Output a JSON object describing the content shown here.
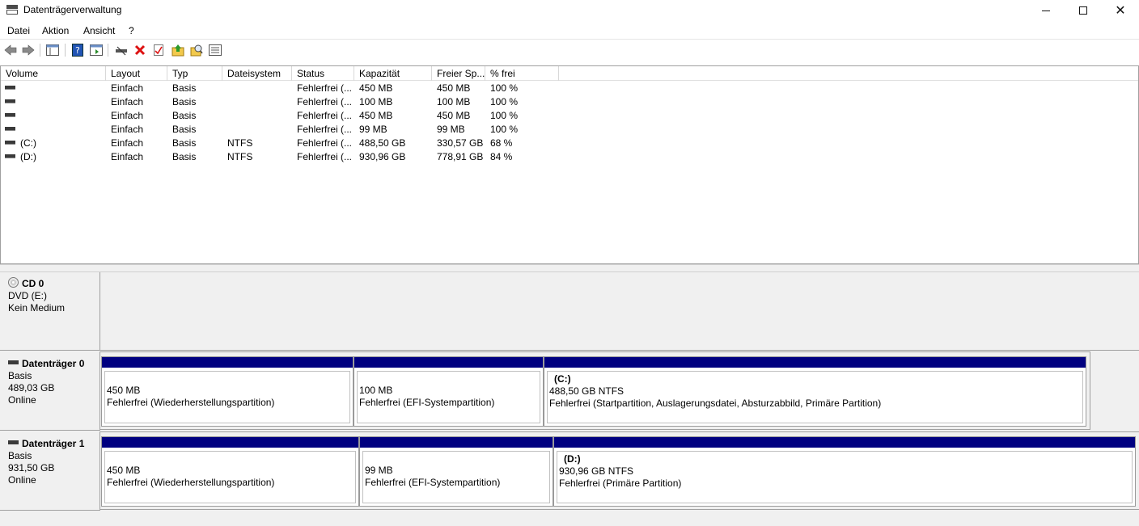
{
  "window": {
    "title": "Datenträgerverwaltung"
  },
  "menu": [
    "Datei",
    "Aktion",
    "Ansicht",
    "?"
  ],
  "toolbar": {
    "icons": [
      "back-arrow-icon",
      "forward-arrow-icon",
      "console-tree-icon",
      "help-icon",
      "action-pane-icon",
      "connect-drive-icon",
      "delete-icon",
      "properties-icon",
      "refresh-icon",
      "rescan-icon",
      "details-view-icon"
    ]
  },
  "volume_list": {
    "columns": [
      "Volume",
      "Layout",
      "Typ",
      "Dateisystem",
      "Status",
      "Kapazität",
      "Freier Sp...",
      "% frei"
    ],
    "rows": [
      {
        "volume": "",
        "layout": "Einfach",
        "typ": "Basis",
        "fs": "",
        "status": "Fehlerfrei (...",
        "kap": "450 MB",
        "frei": "450 MB",
        "pct": "100 %"
      },
      {
        "volume": "",
        "layout": "Einfach",
        "typ": "Basis",
        "fs": "",
        "status": "Fehlerfrei (...",
        "kap": "100 MB",
        "frei": "100 MB",
        "pct": "100 %"
      },
      {
        "volume": "",
        "layout": "Einfach",
        "typ": "Basis",
        "fs": "",
        "status": "Fehlerfrei (...",
        "kap": "450 MB",
        "frei": "450 MB",
        "pct": "100 %"
      },
      {
        "volume": "",
        "layout": "Einfach",
        "typ": "Basis",
        "fs": "",
        "status": "Fehlerfrei (...",
        "kap": "99 MB",
        "frei": "99 MB",
        "pct": "100 %"
      },
      {
        "volume": "(C:)",
        "layout": "Einfach",
        "typ": "Basis",
        "fs": "NTFS",
        "status": "Fehlerfrei (...",
        "kap": "488,50 GB",
        "frei": "330,57 GB",
        "pct": "68 %"
      },
      {
        "volume": "(D:)",
        "layout": "Einfach",
        "typ": "Basis",
        "fs": "NTFS",
        "status": "Fehlerfrei (...",
        "kap": "930,96 GB",
        "frei": "778,91 GB",
        "pct": "84 %"
      }
    ]
  },
  "disks": [
    {
      "name": "CD 0",
      "line1": "DVD (E:)",
      "line2": "",
      "line3": "Kein Medium",
      "partitions": []
    },
    {
      "name": "Datenträger 0",
      "line1": "Basis",
      "line2": "489,03 GB",
      "line3": "Online",
      "partitions": [
        {
          "label": "",
          "size": "450 MB",
          "status": "Fehlerfrei (Wiederherstellungspartition)"
        },
        {
          "label": "",
          "size": "100 MB",
          "status": "Fehlerfrei (EFI-Systempartition)"
        },
        {
          "label": "(C:)",
          "size": "488,50 GB NTFS",
          "status": "Fehlerfrei (Startpartition, Auslagerungsdatei, Absturzabbild, Primäre Partition)"
        }
      ]
    },
    {
      "name": "Datenträger 1",
      "line1": "Basis",
      "line2": "931,50 GB",
      "line3": "Online",
      "partitions": [
        {
          "label": "",
          "size": "450 MB",
          "status": "Fehlerfrei (Wiederherstellungspartition)"
        },
        {
          "label": "",
          "size": "99 MB",
          "status": "Fehlerfrei (EFI-Systempartition)"
        },
        {
          "label": "(D:)",
          "size": "930,96 GB NTFS",
          "status": "Fehlerfrei (Primäre Partition)"
        }
      ]
    }
  ],
  "colors": {
    "partition_bar": "#000080"
  }
}
